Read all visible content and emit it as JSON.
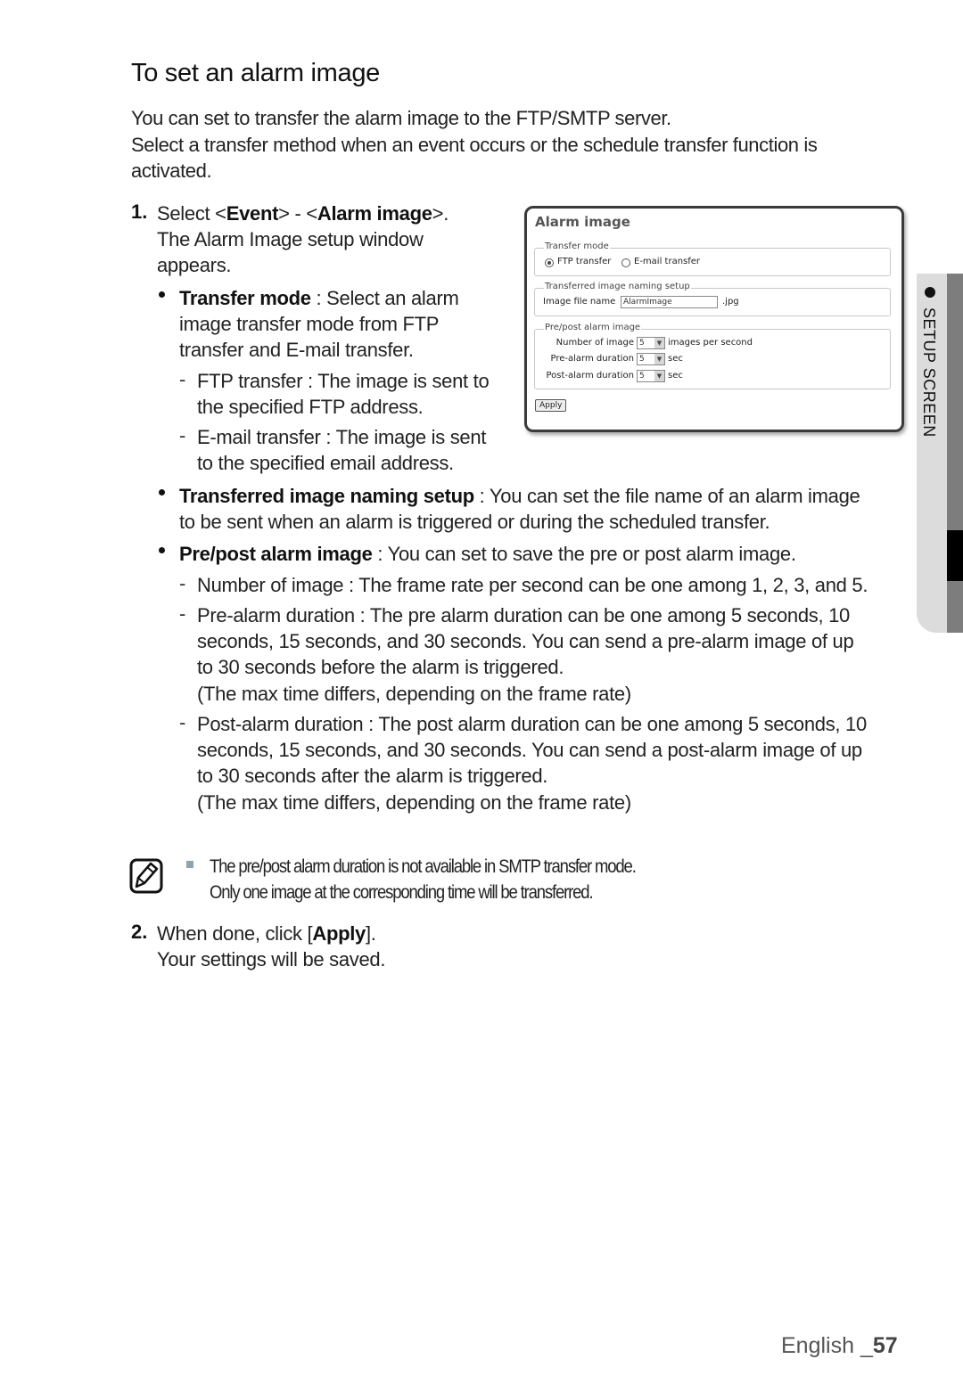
{
  "title": "To set an alarm image",
  "intro": [
    "You can set to transfer the alarm image to the FTP/SMTP server.",
    "Select a transfer method when an event occurs or the schedule transfer function is activated."
  ],
  "step1": {
    "number": "1.",
    "line1_pre": "Select <",
    "line1_b1": "Event",
    "line1_mid": "> - <",
    "line1_b2": "Alarm image",
    "line1_post": ">.",
    "line2": "The Alarm Image setup window",
    "line3": "appears.",
    "bullets": [
      {
        "term": "Transfer mode",
        "lines": [
          " : Select an alarm",
          "image transfer mode from FTP",
          "transfer and E-mail transfer."
        ],
        "subs": [
          {
            "lines": [
              "FTP transfer : The image is sent to",
              "the specified FTP address."
            ]
          },
          {
            "lines": [
              "E-mail transfer : The image is sent",
              "to the specified email address."
            ]
          }
        ]
      },
      {
        "term": "Transferred image naming setup",
        "lines": [
          " : You can set the file name of an alarm image",
          "to be sent when an alarm is triggered or during the scheduled transfer."
        ]
      },
      {
        "term": "Pre/post alarm image",
        "lines": [
          " : You can set to save the pre or post alarm image."
        ],
        "subs": [
          {
            "lines": [
              "Number of image : The frame rate per second can be one among 1, 2, 3, and 5."
            ]
          },
          {
            "lines": [
              "Pre-alarm duration : The pre alarm duration can be one among 5 seconds, 10",
              "seconds, 15 seconds, and 30 seconds. You can send a pre-alarm image of up",
              "to 30 seconds before the alarm is triggered.",
              "(The max time differs, depending on the frame rate)"
            ]
          },
          {
            "lines": [
              "Post-alarm duration : The post alarm duration can be one among 5 seconds, 10",
              "seconds, 15 seconds, and 30 seconds. You can send a post-alarm image of up",
              "to 30 seconds after the alarm is triggered.",
              "(The max time differs, depending on the frame rate)"
            ]
          }
        ]
      }
    ]
  },
  "panel": {
    "title": "Alarm image",
    "transfer_mode": {
      "legend": "Transfer mode",
      "options": [
        {
          "label": "FTP transfer",
          "selected": true
        },
        {
          "label": "E-mail transfer",
          "selected": false
        }
      ]
    },
    "naming": {
      "legend": "Transferred image naming setup",
      "field_label": "Image file name",
      "field_value": "AlarmImage",
      "suffix": ".jpg"
    },
    "prepost": {
      "legend": "Pre/post alarm image",
      "rows": [
        {
          "label": "Number of image",
          "value": "5",
          "unit": "images per second"
        },
        {
          "label": "Pre-alarm duration",
          "value": "5",
          "unit": "sec"
        },
        {
          "label": "Post-alarm duration",
          "value": "5",
          "unit": "sec"
        }
      ]
    },
    "apply_label": "Apply"
  },
  "note": {
    "icon": "note-pencil-icon",
    "lines": [
      "The pre/post alarm duration is not available in SMTP transfer mode.",
      "Only one image at the corresponding time will be transferred."
    ]
  },
  "step2": {
    "number": "2.",
    "line1_pre": "When done, click [",
    "line1_b": "Apply",
    "line1_post": "].",
    "line2": "Your settings will be saved."
  },
  "side_tab": {
    "label": "SETUP SCREEN"
  },
  "footer": {
    "language": "English _",
    "page": "57"
  }
}
